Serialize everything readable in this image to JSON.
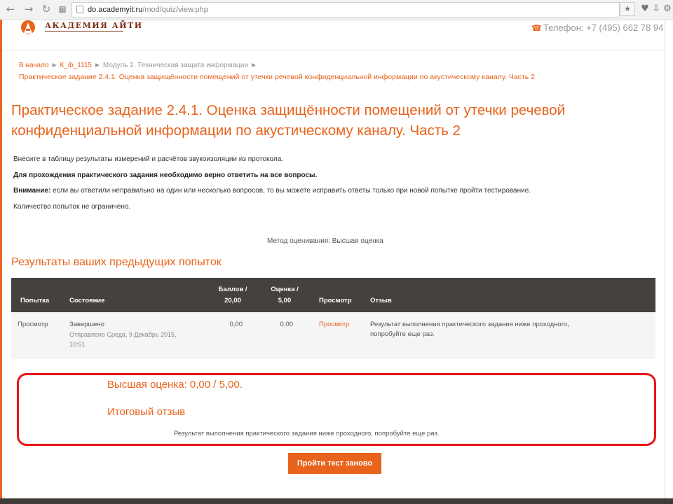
{
  "browser": {
    "url_host": "do.academyit.ru",
    "url_path": "/mod/quiz/view.php"
  },
  "site": {
    "logo_text": "АКАДЕМИЯ АЙТИ",
    "phone": "Телефон: +7 (495) 662 78 94"
  },
  "breadcrumbs": {
    "items": [
      "В начало",
      "К_ib_1115",
      "Модуль 2. Техническая защита информации"
    ],
    "current": "Практическое задание 2.4.1. Оценка защищённости помещений от утечки речевой конфиденциальной информации по акустическому каналу. Часть 2"
  },
  "page": {
    "title_line1": "Практическое задание 2.4.1. Оценка защищённости помещений от утечки речевой",
    "title_line2": "конфиденциальной информации по акустическому каналу. Часть 2",
    "intro1": "Внесите в таблицу результаты измерений и расчётов звукоизоляции из протокола.",
    "intro2": "Для прохождения практического задания необходимо верно ответить на все вопросы.",
    "intro3_bold": "Внимание:",
    "intro3_rest": " если вы ответили неправильно на один или несколько вопросов, то вы можете исправить ответы только при новой попытке пройти тестирование.",
    "intro4": "Количество попыток не ограничено.",
    "grading_method": "Метод оценивания: Высшая оценка"
  },
  "results": {
    "heading": "Результаты ваших предыдущих попыток",
    "columns": {
      "attempt": "Попытка",
      "state": "Состояние",
      "marks_1": "Баллов /",
      "marks_2": "20,00",
      "grade_1": "Оценка /",
      "grade_2": "5,00",
      "review": "Просмотр",
      "feedback": "Отзыв"
    },
    "rows": [
      {
        "attempt": "Просмотр",
        "state": "Завершено",
        "submitted_1": "Отправлено Среда, 9 Декабрь 2015,",
        "submitted_2": "10:51",
        "marks": "0,00",
        "grade": "0,00",
        "review": "Просмотр",
        "feedback_1": "Результат выполнения практического задания ниже проходного,",
        "feedback_2": "попробуйте еще раз."
      }
    ]
  },
  "summary": {
    "best_grade": "Высшая оценка: 0,00 / 5,00.",
    "overall_feedback_title": "Итоговый отзыв",
    "overall_feedback_text": "Результат выполнения практического задания ниже проходного, попробуйте еще раз."
  },
  "actions": {
    "retry_label": "Пройти тест заново"
  },
  "colors": {
    "accent": "#e8631c",
    "highlight": "#e8141b",
    "table_header": "#45413d"
  }
}
